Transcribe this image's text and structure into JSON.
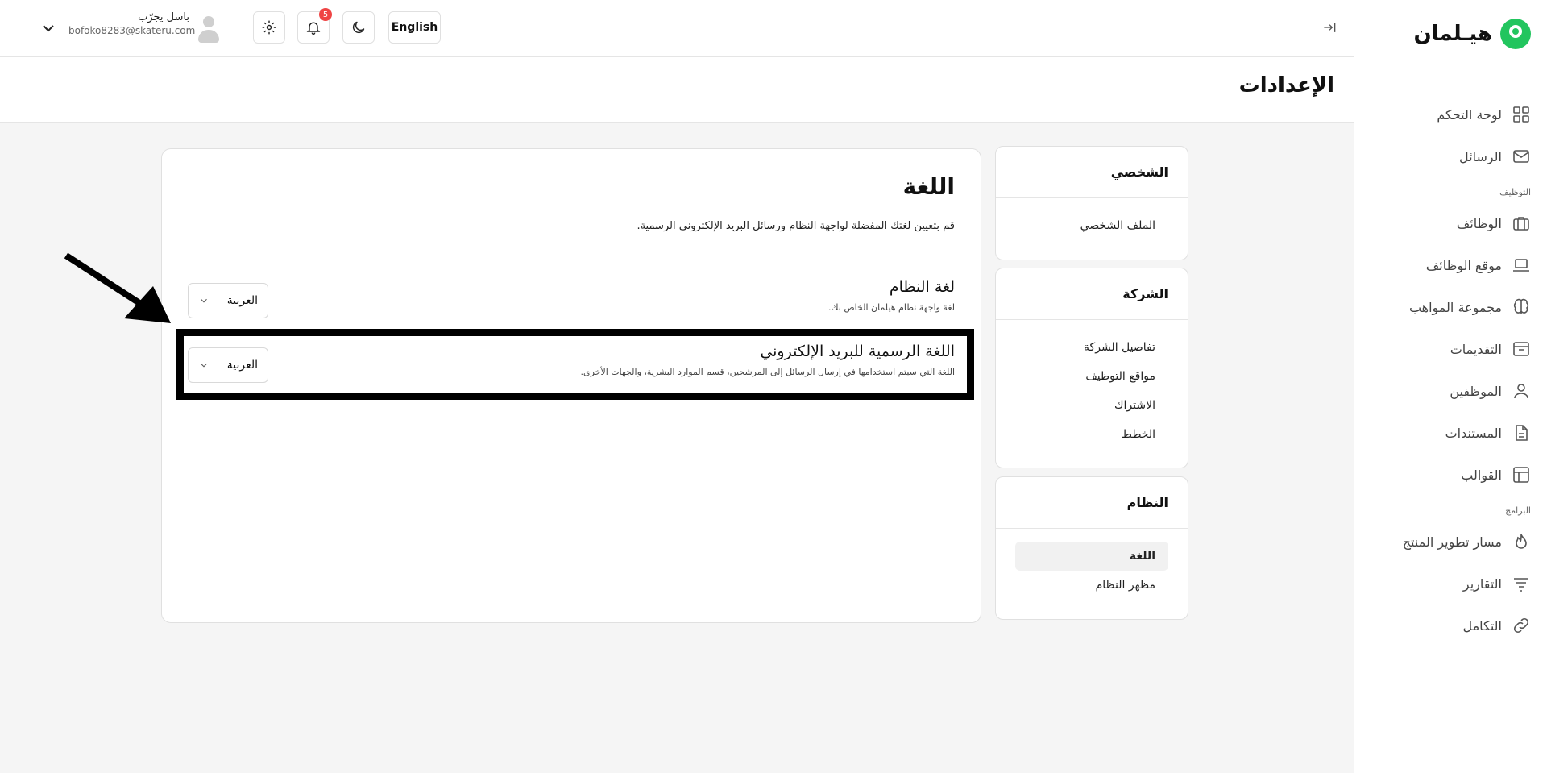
{
  "brand": {
    "name": "هيـلمان"
  },
  "sidebar": {
    "items": [
      {
        "label": "لوحة التحكم",
        "icon": "dashboard-icon"
      },
      {
        "label": "الرسائل",
        "icon": "mail-icon"
      }
    ],
    "section_recruitment": "التوظيف",
    "recruitment_items": [
      {
        "label": "الوظائف",
        "icon": "briefcase-icon"
      },
      {
        "label": "موقع الوظائف",
        "icon": "laptop-icon"
      },
      {
        "label": "مجموعة المواهب",
        "icon": "brain-icon"
      },
      {
        "label": "التقديمات",
        "icon": "inbox-icon"
      },
      {
        "label": "الموظفين",
        "icon": "user-icon"
      },
      {
        "label": "المستندات",
        "icon": "document-icon"
      },
      {
        "label": "القوالب",
        "icon": "template-icon"
      }
    ],
    "section_programs": "البرامج",
    "program_items": [
      {
        "label": "مسار تطوير المنتج",
        "icon": "flame-icon"
      },
      {
        "label": "التقارير",
        "icon": "filter-icon"
      },
      {
        "label": "التكامل",
        "icon": "link-icon"
      }
    ]
  },
  "topbar": {
    "user_name": "باسل يجرّب",
    "user_email": "bofoko8283@skateru.com",
    "notification_count": "5",
    "language_button": "English"
  },
  "page": {
    "title": "الإعدادات"
  },
  "settings_menu": {
    "personal": {
      "title": "الشخصي",
      "links": [
        "الملف الشخصي"
      ]
    },
    "company": {
      "title": "الشركة",
      "links": [
        "تفاصيل الشركة",
        "مواقع التوظيف",
        "الاشتراك",
        "الخطط"
      ]
    },
    "system": {
      "title": "النظام",
      "links": [
        "اللغة",
        "مظهر النظام"
      ],
      "active": "اللغة"
    }
  },
  "language_section": {
    "title": "اللغة",
    "description": "قم بتعيين لغتك المفضلة لواجهة النظام ورسائل البريد الإلكتروني الرسمية.",
    "system_language": {
      "title": "لغة النظام",
      "help": "لغة واجهة نظام هيلمان الخاص بك.",
      "value": "العربية"
    },
    "email_language": {
      "title": "اللغة الرسمية للبريد الإلكتروني",
      "help": "اللغة التي سيتم استخدامها في إرسال الرسائل إلى المرشحين، قسم الموارد البشرية، والجهات الأخرى.",
      "value": "العربية"
    }
  }
}
